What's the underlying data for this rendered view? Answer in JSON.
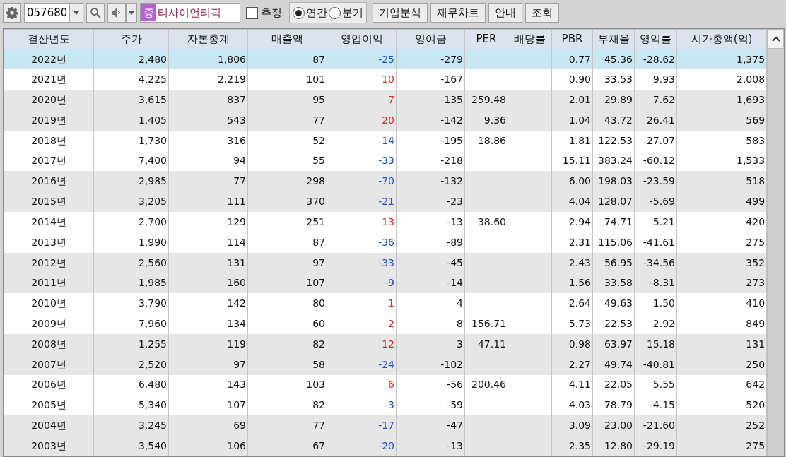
{
  "toolbar": {
    "code": "057680",
    "badge": "증",
    "company": "티사이언티픽",
    "estimate": {
      "label": "추정",
      "checked": false
    },
    "periods": [
      {
        "label": "연간",
        "selected": true
      },
      {
        "label": "분기",
        "selected": false
      }
    ],
    "buttons": [
      "기업분석",
      "재무차트",
      "안내",
      "조회"
    ]
  },
  "table": {
    "columns": [
      "결산년도",
      "주가",
      "자본총계",
      "매출액",
      "영업이익",
      "잉여금",
      "PER",
      "배당률",
      "PBR",
      "부채율",
      "영익률",
      "시가총액(억)"
    ],
    "rows": [
      {
        "selected": true,
        "color": "#1e50d2",
        "cells": [
          "2022년",
          "2,480",
          "1,806",
          "87",
          "-25",
          "-279",
          "",
          "",
          "0.77",
          "45.36",
          "-28.62",
          "1,375"
        ]
      },
      {
        "selected": false,
        "color": "#e8231e",
        "cells": [
          "2021년",
          "4,225",
          "2,219",
          "101",
          "10",
          "-167",
          "",
          "",
          "0.90",
          "33.53",
          "9.93",
          "2,008"
        ]
      },
      {
        "selected": false,
        "color": "#e8231e",
        "cells": [
          "2020년",
          "3,615",
          "837",
          "95",
          "7",
          "-135",
          "259.48",
          "",
          "2.01",
          "29.89",
          "7.62",
          "1,693"
        ]
      },
      {
        "selected": false,
        "color": "#e8231e",
        "cells": [
          "2019년",
          "1,405",
          "543",
          "77",
          "20",
          "-142",
          "9.36",
          "",
          "1.04",
          "43.72",
          "26.41",
          "569"
        ]
      },
      {
        "selected": false,
        "color": "#1e50d2",
        "cells": [
          "2018년",
          "1,730",
          "316",
          "52",
          "-14",
          "-195",
          "18.86",
          "",
          "1.81",
          "122.53",
          "-27.07",
          "583"
        ]
      },
      {
        "selected": false,
        "color": "#1e50d2",
        "cells": [
          "2017년",
          "7,400",
          "94",
          "55",
          "-33",
          "-218",
          "",
          "",
          "15.11",
          "383.24",
          "-60.12",
          "1,533"
        ]
      },
      {
        "selected": false,
        "color": "#1e50d2",
        "cells": [
          "2016년",
          "2,985",
          "77",
          "298",
          "-70",
          "-132",
          "",
          "",
          "6.00",
          "198.03",
          "-23.59",
          "518"
        ]
      },
      {
        "selected": false,
        "color": "#1e50d2",
        "cells": [
          "2015년",
          "3,205",
          "111",
          "370",
          "-21",
          "-23",
          "",
          "",
          "4.04",
          "128.07",
          "-5.69",
          "499"
        ]
      },
      {
        "selected": false,
        "color": "#e8231e",
        "cells": [
          "2014년",
          "2,700",
          "129",
          "251",
          "13",
          "-13",
          "38.60",
          "",
          "2.94",
          "74.71",
          "5.21",
          "420"
        ]
      },
      {
        "selected": false,
        "color": "#1e50d2",
        "cells": [
          "2013년",
          "1,990",
          "114",
          "87",
          "-36",
          "-89",
          "",
          "",
          "2.31",
          "115.06",
          "-41.61",
          "275"
        ]
      },
      {
        "selected": false,
        "color": "#1e50d2",
        "cells": [
          "2012년",
          "2,560",
          "131",
          "97",
          "-33",
          "-45",
          "",
          "",
          "2.43",
          "56.95",
          "-34.56",
          "352"
        ]
      },
      {
        "selected": false,
        "color": "#1e50d2",
        "cells": [
          "2011년",
          "1,985",
          "160",
          "107",
          "-9",
          "-14",
          "",
          "",
          "1.56",
          "33.58",
          "-8.31",
          "273"
        ]
      },
      {
        "selected": false,
        "color": "#e8231e",
        "cells": [
          "2010년",
          "3,790",
          "142",
          "80",
          "1",
          "4",
          "",
          "",
          "2.64",
          "49.63",
          "1.50",
          "410"
        ]
      },
      {
        "selected": false,
        "color": "#e8231e",
        "cells": [
          "2009년",
          "7,960",
          "134",
          "60",
          "2",
          "8",
          "156.71",
          "",
          "5.73",
          "22.53",
          "2.92",
          "849"
        ]
      },
      {
        "selected": false,
        "color": "#e8231e",
        "cells": [
          "2008년",
          "1,255",
          "119",
          "82",
          "12",
          "3",
          "47.11",
          "",
          "0.98",
          "63.97",
          "15.18",
          "131"
        ]
      },
      {
        "selected": false,
        "color": "#1e50d2",
        "cells": [
          "2007년",
          "2,520",
          "97",
          "58",
          "-24",
          "-102",
          "",
          "",
          "2.27",
          "49.74",
          "-40.81",
          "250"
        ]
      },
      {
        "selected": false,
        "color": "#e8231e",
        "cells": [
          "2006년",
          "6,480",
          "143",
          "103",
          "6",
          "-56",
          "200.46",
          "",
          "4.11",
          "22.05",
          "5.55",
          "642"
        ]
      },
      {
        "selected": false,
        "color": "#1e50d2",
        "cells": [
          "2005년",
          "5,340",
          "107",
          "82",
          "-3",
          "-59",
          "",
          "",
          "4.03",
          "78.79",
          "-4.15",
          "520"
        ]
      },
      {
        "selected": false,
        "color": "#1e50d2",
        "cells": [
          "2004년",
          "3,245",
          "69",
          "77",
          "-17",
          "-47",
          "",
          "",
          "3.09",
          "23.00",
          "-21.60",
          "252"
        ]
      },
      {
        "selected": false,
        "color": "#1e50d2",
        "cells": [
          "2003년",
          "3,540",
          "106",
          "67",
          "-20",
          "-13",
          "",
          "",
          "2.35",
          "12.80",
          "-29.19",
          "275"
        ]
      }
    ]
  }
}
